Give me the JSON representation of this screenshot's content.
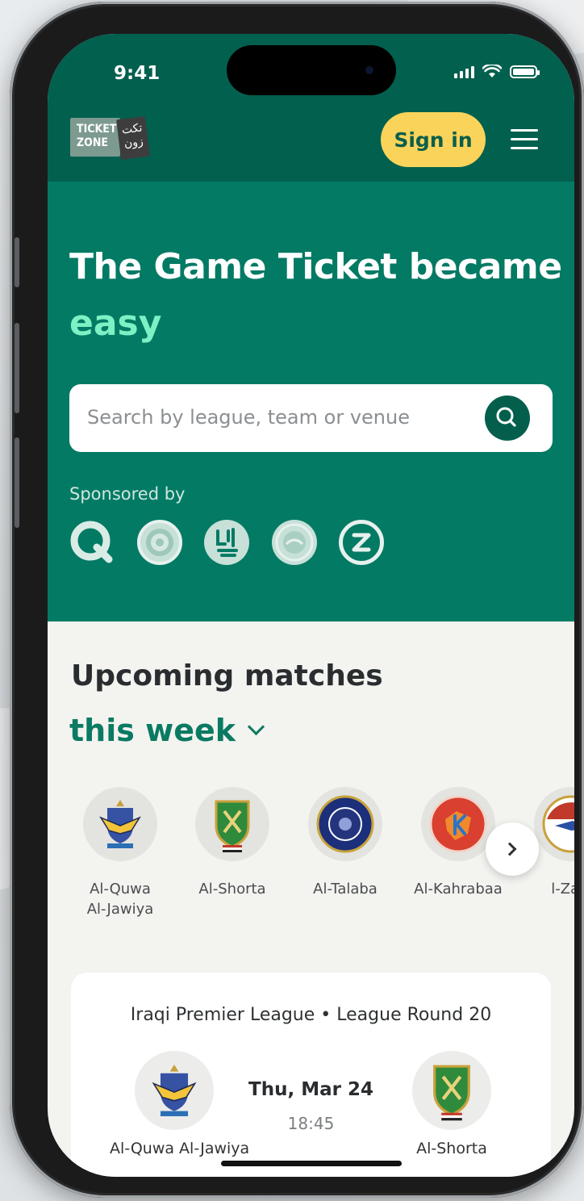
{
  "status_bar": {
    "time": "9:41"
  },
  "header": {
    "logo_line1": "TICKET",
    "logo_line2": "ZONE",
    "logo_arabic_line1": "تكت",
    "logo_arabic_line2": "زون",
    "signin_label": "Sign in"
  },
  "hero": {
    "title": "The Game Ticket became",
    "title_accent": "easy",
    "search_placeholder": "Search by league, team or venue",
    "sponsored_label": "Sponsored by"
  },
  "upcoming": {
    "title": "Upcoming matches",
    "period": "this week",
    "teams": [
      {
        "name_line1": "Al-Quwa",
        "name_line2": "Al-Jawiya"
      },
      {
        "name_line1": "Al-Shorta",
        "name_line2": ""
      },
      {
        "name_line1": "Al-Talaba",
        "name_line2": ""
      },
      {
        "name_line1": "Al-Kahrabaa",
        "name_line2": ""
      },
      {
        "name_line1": "l-Zaw",
        "name_line2": ""
      }
    ]
  },
  "match": {
    "league": "Iraqi Premier League",
    "round": "League Round 20",
    "home": "Al-Quwa Al-Jawiya",
    "away": "Al-Shorta",
    "date": "Thu, Mar 24",
    "time": "18:45"
  },
  "colors": {
    "brand_green": "#037a64",
    "header_green": "#02604e",
    "accent_yellow": "#fad45a",
    "accent_mint": "#7ef1c4"
  }
}
